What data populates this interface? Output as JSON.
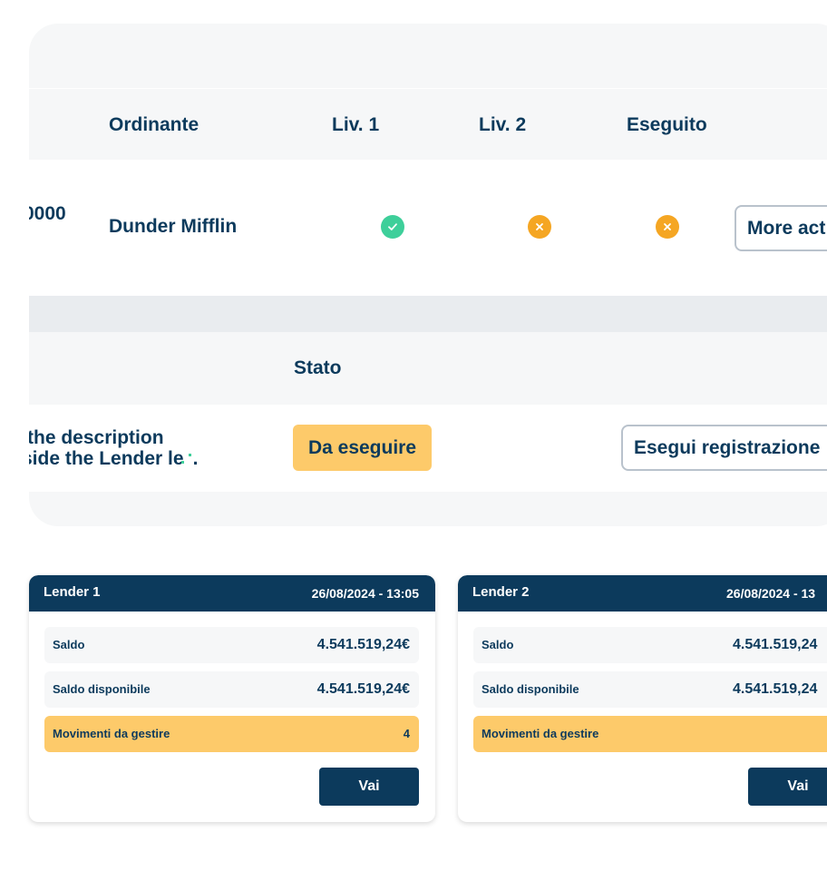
{
  "table1": {
    "headers": {
      "ordinante": "Ordinante",
      "liv1": "Liv. 1",
      "liv2": "Liv. 2",
      "eseguito": "Eseguito"
    },
    "row": {
      "id_fragment": "0000",
      "ordinante": "Dunder Mifflin",
      "liv1_status": "check-icon",
      "liv2_status": "x-icon",
      "eseguito_status": "x-icon",
      "action_label": "More act"
    }
  },
  "table2": {
    "headers": {
      "stato": "Stato"
    },
    "row": {
      "description_line1": "the description",
      "description_line2": "side the Lender le",
      "description_line2_end": ".",
      "stato": "Da eseguire",
      "action_label": "Esegui registrazione"
    }
  },
  "colors": {
    "navy": "#0c3a5c",
    "success": "#3ecf9a",
    "warning": "#f5a623",
    "badge": "#fdca6a"
  },
  "lenders": [
    {
      "title": "Lender 1",
      "datetime": "26/08/2024 - 13:05",
      "saldo_label": "Saldo",
      "saldo_value": "4.541.519,24€",
      "saldo_disp_label": "Saldo disponibile",
      "saldo_disp_value": "4.541.519,24€",
      "movimenti_label": "Movimenti da gestire",
      "movimenti_value": "4",
      "button_label": "Vai"
    },
    {
      "title": "Lender 2",
      "datetime": "26/08/2024 - 13",
      "saldo_label": "Saldo",
      "saldo_value": "4.541.519,24",
      "saldo_disp_label": "Saldo disponibile",
      "saldo_disp_value": "4.541.519,24",
      "movimenti_label": "Movimenti da gestire",
      "movimenti_value": "",
      "button_label": "Vai"
    }
  ]
}
